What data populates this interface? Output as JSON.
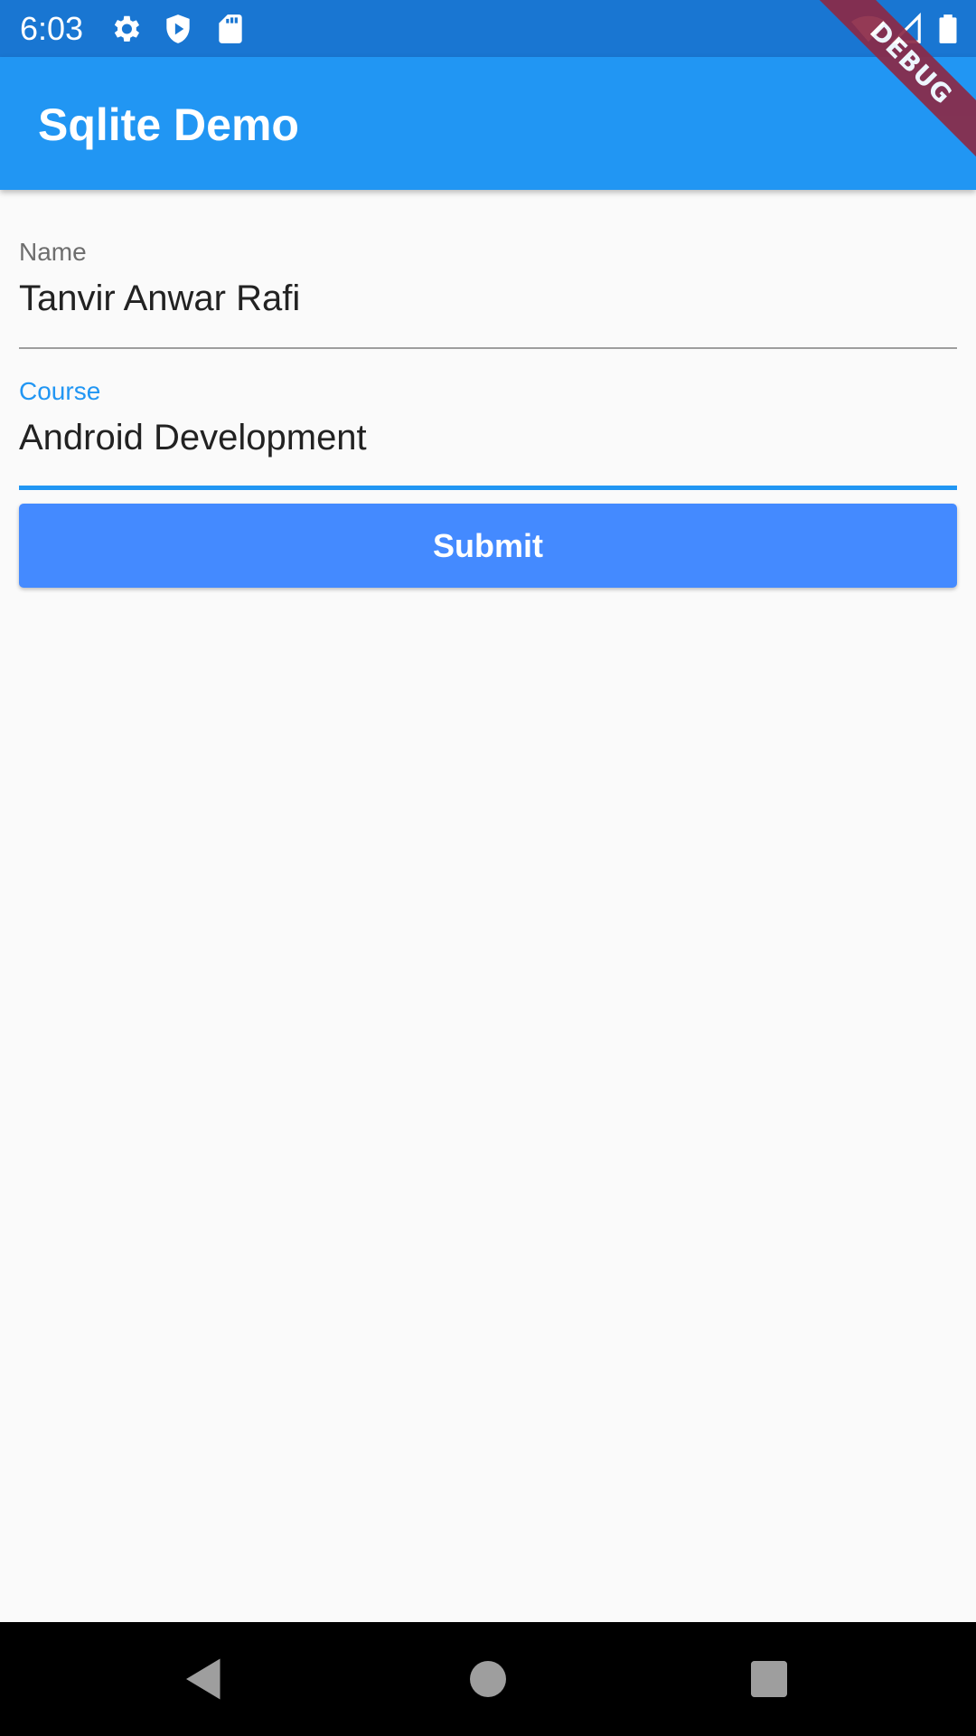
{
  "status_bar": {
    "time": "6:03",
    "icons": [
      "gear-icon",
      "shield-play-icon",
      "sd-card-icon",
      "wifi-icon",
      "signal-icon",
      "battery-icon"
    ]
  },
  "app_bar": {
    "title": "Sqlite Demo"
  },
  "debug_banner": {
    "label": "DEBUG"
  },
  "form": {
    "name_field": {
      "label": "Name",
      "value": "Tanvir Anwar Rafi"
    },
    "course_field": {
      "label": "Course",
      "value": "Android Development"
    },
    "submit_label": "Submit"
  },
  "nav_bar": {
    "buttons": [
      "back-icon",
      "home-icon",
      "recents-icon"
    ]
  },
  "colors": {
    "status_bar": "#1976d2",
    "app_bar": "#2196f3",
    "accent": "#2196f3",
    "button": "#448aff",
    "debug_banner": "#8b2a47"
  }
}
